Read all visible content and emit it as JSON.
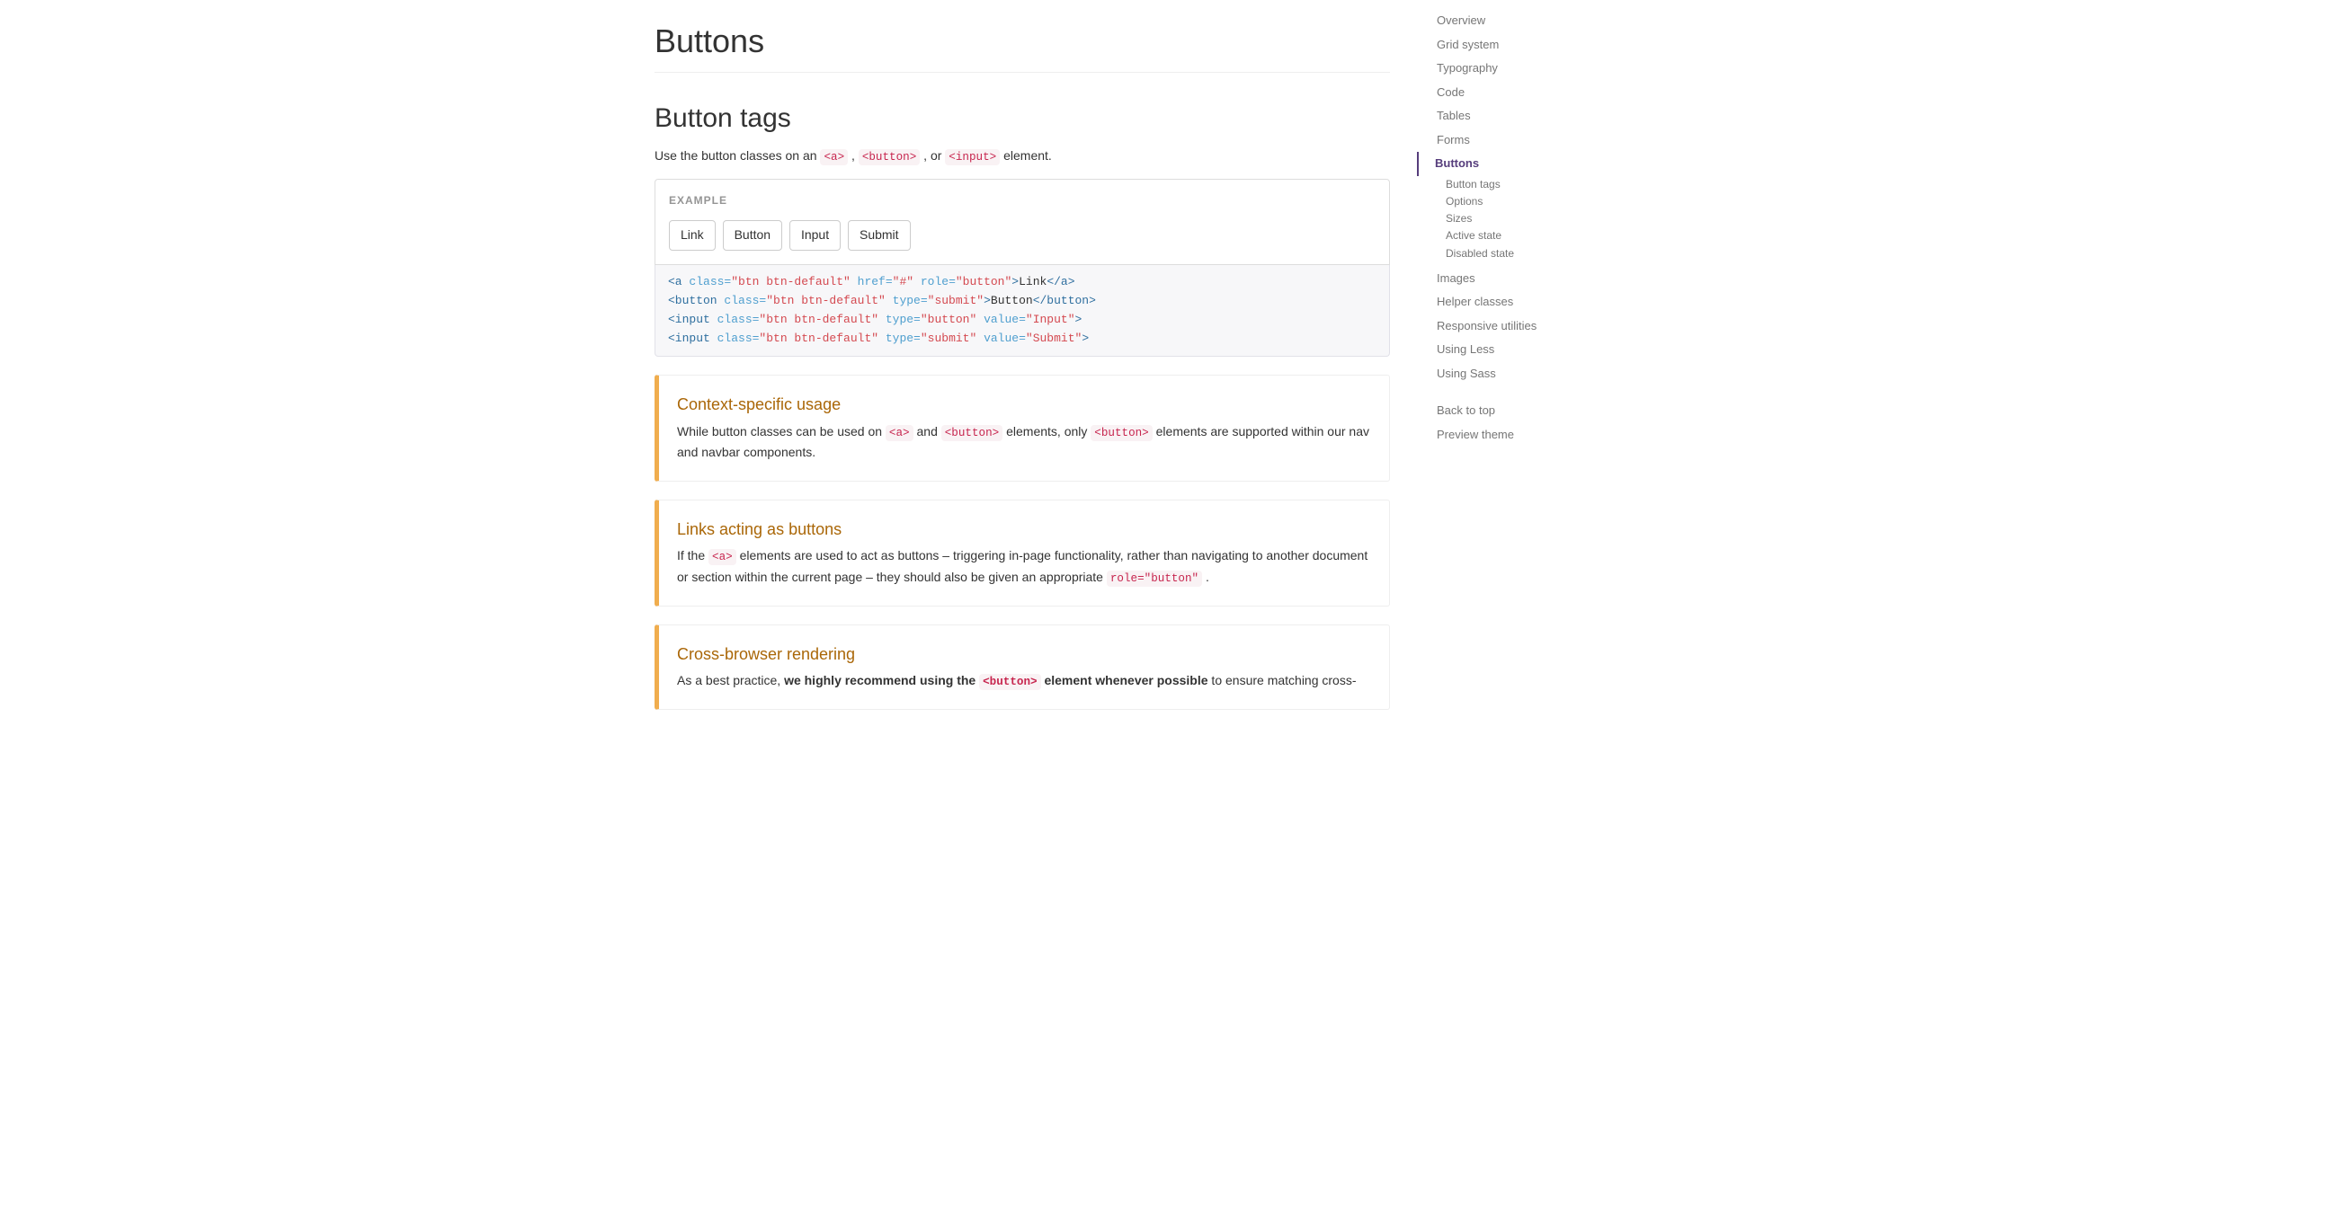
{
  "header": {
    "title": "Buttons"
  },
  "section": {
    "title": "Button tags",
    "intro_pre": "Use the button classes on an ",
    "intro_a": "<a>",
    "intro_sep1": " , ",
    "intro_button": "<button>",
    "intro_sep2": " , or ",
    "intro_input": "<input>",
    "intro_post": " element."
  },
  "example": {
    "label": "Example",
    "link": "Link",
    "button": "Button",
    "input": "Input",
    "submit": "Submit"
  },
  "code_tokens": {
    "l1": {
      "open": "<a",
      "a1n": " class=",
      "a1v": "\"btn btn-default\"",
      "a2n": " href=",
      "a2v": "\"#\"",
      "a3n": " role=",
      "a3v": "\"button\"",
      "gt": ">",
      "text": "Link",
      "close": "</a>"
    },
    "l2": {
      "open": "<button",
      "a1n": " class=",
      "a1v": "\"btn btn-default\"",
      "a2n": " type=",
      "a2v": "\"submit\"",
      "gt": ">",
      "text": "Button",
      "close": "</button>"
    },
    "l3": {
      "open": "<input",
      "a1n": " class=",
      "a1v": "\"btn btn-default\"",
      "a2n": " type=",
      "a2v": "\"button\"",
      "a3n": " value=",
      "a3v": "\"Input\"",
      "gt": ">"
    },
    "l4": {
      "open": "<input",
      "a1n": " class=",
      "a1v": "\"btn btn-default\"",
      "a2n": " type=",
      "a2v": "\"submit\"",
      "a3n": " value=",
      "a3v": "\"Submit\"",
      "gt": ">"
    }
  },
  "callouts": {
    "c1": {
      "title": "Context-specific usage",
      "t1": "While button classes can be used on ",
      "code1": "<a>",
      "t2": " and ",
      "code2": "<button>",
      "t3": " elements, only ",
      "code3": "<button>",
      "t4": " elements are supported within our nav and navbar components."
    },
    "c2": {
      "title": "Links acting as buttons",
      "t1": "If the ",
      "code1": "<a>",
      "t2": " elements are used to act as buttons – triggering in-page functionality, rather than navigating to another document or section within the current page – they should also be given an appropriate ",
      "code2": "role=\"button\"",
      "t3": " ."
    },
    "c3": {
      "title": "Cross-browser rendering",
      "t1": "As a best practice, ",
      "bold1": "we highly recommend using the ",
      "code1": "<button>",
      "bold2": " element whenever possible",
      "t2": " to ensure matching cross-"
    }
  },
  "sidenav": {
    "items": [
      {
        "label": "Overview"
      },
      {
        "label": "Grid system"
      },
      {
        "label": "Typography"
      },
      {
        "label": "Code"
      },
      {
        "label": "Tables"
      },
      {
        "label": "Forms"
      },
      {
        "label": "Buttons",
        "active": true,
        "sub": [
          {
            "label": "Button tags"
          },
          {
            "label": "Options"
          },
          {
            "label": "Sizes"
          },
          {
            "label": "Active state"
          },
          {
            "label": "Disabled state"
          }
        ]
      },
      {
        "label": "Images"
      },
      {
        "label": "Helper classes"
      },
      {
        "label": "Responsive utilities"
      },
      {
        "label": "Using Less"
      },
      {
        "label": "Using Sass"
      }
    ],
    "back": [
      {
        "label": "Back to top"
      },
      {
        "label": "Preview theme"
      }
    ]
  }
}
